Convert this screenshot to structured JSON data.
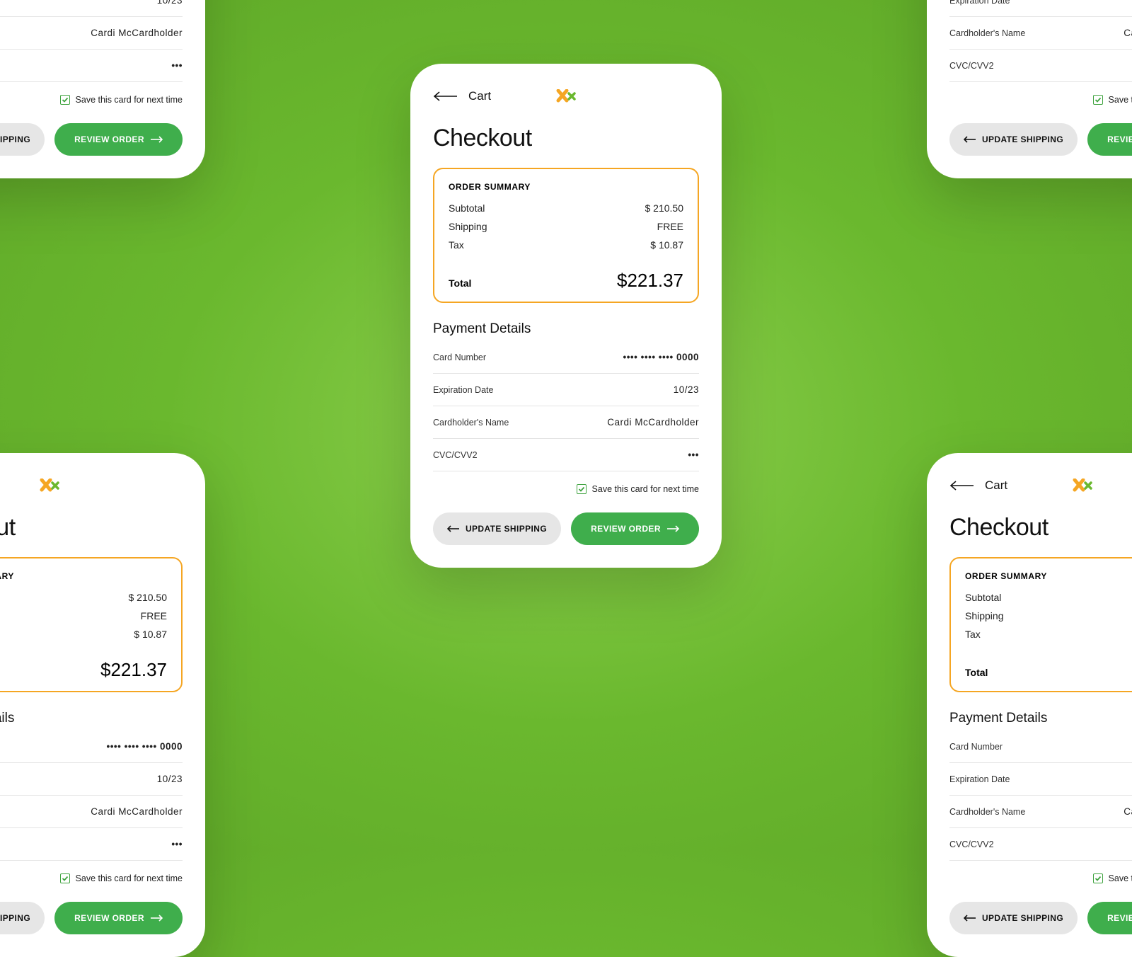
{
  "nav": {
    "back_label": "Cart"
  },
  "page_title": "Checkout",
  "summary": {
    "heading": "ORDER SUMMARY",
    "rows": [
      {
        "label": "Subtotal",
        "value": "$  210.50"
      },
      {
        "label": "Shipping",
        "value": "FREE"
      },
      {
        "label": "Tax",
        "value": "$   10.87"
      }
    ],
    "total_label": "Total",
    "total_value": "$221.37"
  },
  "payment": {
    "heading": "Payment Details",
    "fields": [
      {
        "label": "Card Number",
        "value": "••••  ••••  ••••   0000"
      },
      {
        "label": "Expiration Date",
        "value": "10/23"
      },
      {
        "label": "Cardholder's Name",
        "value": "Cardi McCardholder"
      },
      {
        "label": "CVC/CVV2",
        "value": "•••"
      }
    ],
    "save_label": "Save this card for next time"
  },
  "actions": {
    "secondary": "UPDATE SHIPPING",
    "primary": "REVIEW ORDER"
  },
  "colors": {
    "accent_orange": "#f5a623",
    "accent_green": "#3fae4c"
  }
}
